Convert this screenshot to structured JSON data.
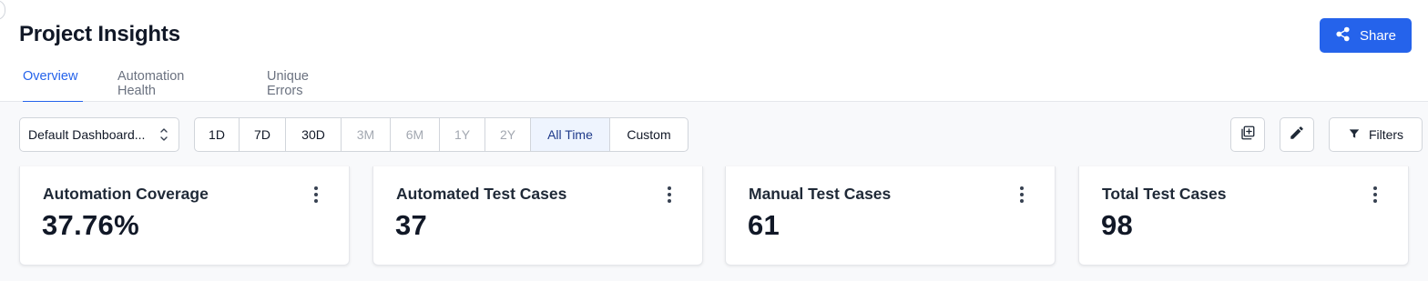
{
  "header": {
    "title": "Project Insights",
    "share_label": "Share",
    "share_icon": "share-icon",
    "accent_color": "#2563eb"
  },
  "tabs": [
    {
      "label": "Overview",
      "active": true
    },
    {
      "label": "Automation Health",
      "active": false
    },
    {
      "label": "Unique Errors",
      "active": false
    }
  ],
  "toolbar": {
    "dashboard_select": {
      "value": "Default Dashboard...",
      "icon": "chevron-up-down-icon"
    },
    "time_ranges": [
      {
        "label": "1D",
        "state": "enabled"
      },
      {
        "label": "7D",
        "state": "enabled"
      },
      {
        "label": "30D",
        "state": "enabled"
      },
      {
        "label": "3M",
        "state": "disabled"
      },
      {
        "label": "6M",
        "state": "disabled"
      },
      {
        "label": "1Y",
        "state": "disabled"
      },
      {
        "label": "2Y",
        "state": "disabled"
      },
      {
        "label": "All Time",
        "state": "selected"
      },
      {
        "label": "Custom",
        "state": "enabled"
      }
    ],
    "add_widget_icon": "add-widget-icon",
    "edit_icon": "pencil-icon",
    "filters_label": "Filters",
    "filters_icon": "filter-icon"
  },
  "cards": [
    {
      "title": "Automation Coverage",
      "value": "37.76%"
    },
    {
      "title": "Automated Test Cases",
      "value": "37"
    },
    {
      "title": "Manual Test Cases",
      "value": "61"
    },
    {
      "title": "Total Test Cases",
      "value": "98"
    }
  ]
}
